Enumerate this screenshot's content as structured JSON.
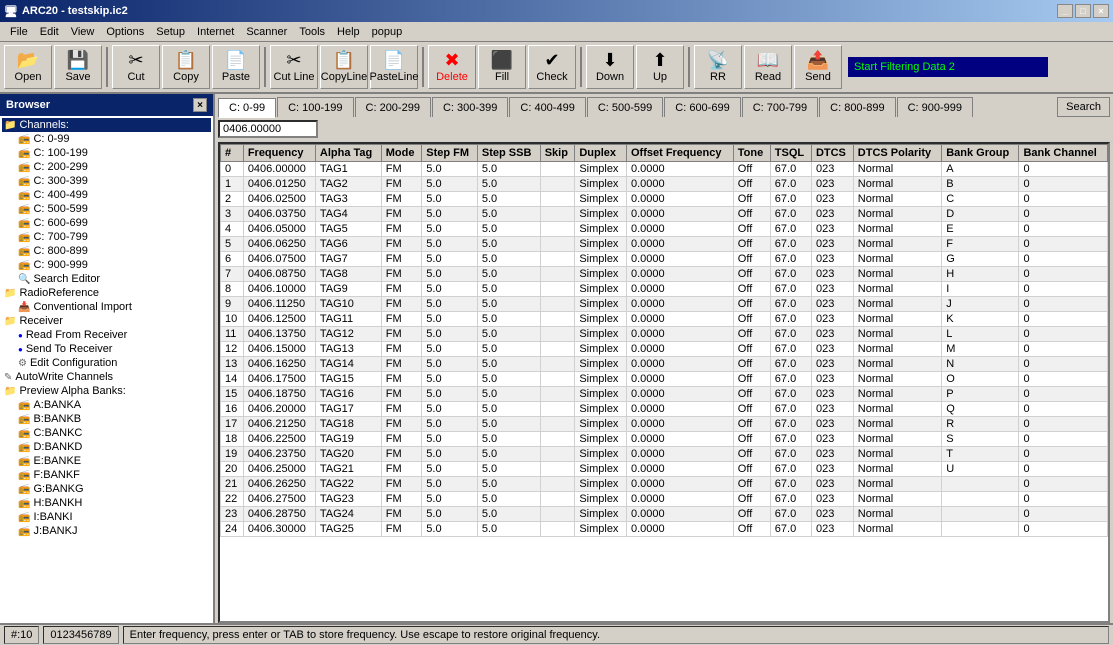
{
  "titleBar": {
    "title": "ARC20 - testskip.ic2",
    "controls": [
      "_",
      "□",
      "×"
    ]
  },
  "menuBar": {
    "items": [
      "File",
      "Edit",
      "View",
      "Options",
      "Setup",
      "Internet",
      "Scanner",
      "Tools",
      "Help",
      "popup"
    ]
  },
  "toolbar": {
    "buttons": [
      {
        "label": "Open",
        "icon": "📂"
      },
      {
        "label": "Save",
        "icon": "💾"
      },
      {
        "label": "Cut",
        "icon": "✂"
      },
      {
        "label": "Copy",
        "icon": "📋"
      },
      {
        "label": "Paste",
        "icon": "📄"
      },
      {
        "label": "Cut Line",
        "icon": "✂"
      },
      {
        "label": "CopyLine",
        "icon": "📋"
      },
      {
        "label": "PasteLine",
        "icon": "📄"
      },
      {
        "label": "Delete",
        "icon": "✖"
      },
      {
        "label": "Fill",
        "icon": "⬛"
      },
      {
        "label": "Check",
        "icon": "✔"
      },
      {
        "label": "Down",
        "icon": "⬇"
      },
      {
        "label": "Up",
        "icon": "⬆"
      },
      {
        "label": "RR",
        "icon": "📡"
      },
      {
        "label": "Read",
        "icon": "📖"
      },
      {
        "label": "Send",
        "icon": "📤"
      }
    ],
    "statusText": "Start Filtering Data 2"
  },
  "browser": {
    "title": "Browser",
    "tree": [
      {
        "label": "Channels:",
        "level": 0,
        "type": "folder",
        "selected": true
      },
      {
        "label": "C: 0-99",
        "level": 1,
        "type": "channel"
      },
      {
        "label": "C: 100-199",
        "level": 1,
        "type": "channel"
      },
      {
        "label": "C: 200-299",
        "level": 1,
        "type": "channel"
      },
      {
        "label": "C: 300-399",
        "level": 1,
        "type": "channel"
      },
      {
        "label": "C: 400-499",
        "level": 1,
        "type": "channel"
      },
      {
        "label": "C: 500-599",
        "level": 1,
        "type": "channel"
      },
      {
        "label": "C: 600-699",
        "level": 1,
        "type": "channel"
      },
      {
        "label": "C: 700-799",
        "level": 1,
        "type": "channel"
      },
      {
        "label": "C: 800-899",
        "level": 1,
        "type": "channel"
      },
      {
        "label": "C: 900-999",
        "level": 1,
        "type": "channel"
      },
      {
        "label": "Search Editor",
        "level": 1,
        "type": "item"
      },
      {
        "label": "RadioReference",
        "level": 0,
        "type": "folder"
      },
      {
        "label": "Conventional Import",
        "level": 1,
        "type": "item"
      },
      {
        "label": "Receiver",
        "level": 0,
        "type": "folder"
      },
      {
        "label": "Read From Receiver",
        "level": 1,
        "type": "dot"
      },
      {
        "label": "Send To Receiver",
        "level": 1,
        "type": "dot"
      },
      {
        "label": "Edit Configuration",
        "level": 1,
        "type": "item"
      },
      {
        "label": "AutoWrite Channels",
        "level": 0,
        "type": "item"
      },
      {
        "label": "Preview Alpha Banks:",
        "level": 0,
        "type": "folder"
      },
      {
        "label": "A:BANKA",
        "level": 1,
        "type": "channel"
      },
      {
        "label": "B:BANKB",
        "level": 1,
        "type": "channel"
      },
      {
        "label": "C:BANKC",
        "level": 1,
        "type": "channel"
      },
      {
        "label": "D:BANKD",
        "level": 1,
        "type": "channel"
      },
      {
        "label": "E:BANKE",
        "level": 1,
        "type": "channel"
      },
      {
        "label": "F:BANKF",
        "level": 1,
        "type": "channel"
      },
      {
        "label": "G:BANKG",
        "level": 1,
        "type": "channel"
      },
      {
        "label": "H:BANKH",
        "level": 1,
        "type": "channel"
      },
      {
        "label": "I:BANKI",
        "level": 1,
        "type": "channel"
      },
      {
        "label": "J:BANKJ",
        "level": 1,
        "type": "channel"
      }
    ]
  },
  "tabs": {
    "items": [
      "C: 0-99",
      "C: 100-199",
      "C: 200-299",
      "C: 300-399",
      "C: 400-499",
      "C: 500-599",
      "C: 600-699",
      "C: 700-799",
      "C: 800-899",
      "C: 900-999"
    ],
    "active": 0,
    "search": "Search"
  },
  "freqInput": {
    "value": "0406.00000"
  },
  "table": {
    "columns": [
      "#",
      "Frequency",
      "Alpha Tag",
      "Mode",
      "Step FM",
      "Step SSB",
      "Skip",
      "Duplex",
      "Offset Frequency",
      "Tone",
      "TSQL",
      "DTCS",
      "DTCS Polarity",
      "Bank Group",
      "Bank Channel"
    ],
    "rows": [
      [
        0,
        "0406.00000",
        "TAG1",
        "FM",
        "5.0",
        "5.0",
        "",
        "Simplex",
        "0.0000",
        "Off",
        "67.0",
        "023",
        "Normal",
        "A",
        0
      ],
      [
        1,
        "0406.01250",
        "TAG2",
        "FM",
        "5.0",
        "5.0",
        "",
        "Simplex",
        "0.0000",
        "Off",
        "67.0",
        "023",
        "Normal",
        "B",
        0
      ],
      [
        2,
        "0406.02500",
        "TAG3",
        "FM",
        "5.0",
        "5.0",
        "",
        "Simplex",
        "0.0000",
        "Off",
        "67.0",
        "023",
        "Normal",
        "C",
        0
      ],
      [
        3,
        "0406.03750",
        "TAG4",
        "FM",
        "5.0",
        "5.0",
        "",
        "Simplex",
        "0.0000",
        "Off",
        "67.0",
        "023",
        "Normal",
        "D",
        0
      ],
      [
        4,
        "0406.05000",
        "TAG5",
        "FM",
        "5.0",
        "5.0",
        "",
        "Simplex",
        "0.0000",
        "Off",
        "67.0",
        "023",
        "Normal",
        "E",
        0
      ],
      [
        5,
        "0406.06250",
        "TAG6",
        "FM",
        "5.0",
        "5.0",
        "",
        "Simplex",
        "0.0000",
        "Off",
        "67.0",
        "023",
        "Normal",
        "F",
        0
      ],
      [
        6,
        "0406.07500",
        "TAG7",
        "FM",
        "5.0",
        "5.0",
        "",
        "Simplex",
        "0.0000",
        "Off",
        "67.0",
        "023",
        "Normal",
        "G",
        0
      ],
      [
        7,
        "0406.08750",
        "TAG8",
        "FM",
        "5.0",
        "5.0",
        "",
        "Simplex",
        "0.0000",
        "Off",
        "67.0",
        "023",
        "Normal",
        "H",
        0
      ],
      [
        8,
        "0406.10000",
        "TAG9",
        "FM",
        "5.0",
        "5.0",
        "",
        "Simplex",
        "0.0000",
        "Off",
        "67.0",
        "023",
        "Normal",
        "I",
        0
      ],
      [
        9,
        "0406.11250",
        "TAG10",
        "FM",
        "5.0",
        "5.0",
        "",
        "Simplex",
        "0.0000",
        "Off",
        "67.0",
        "023",
        "Normal",
        "J",
        0
      ],
      [
        10,
        "0406.12500",
        "TAG11",
        "FM",
        "5.0",
        "5.0",
        "",
        "Simplex",
        "0.0000",
        "Off",
        "67.0",
        "023",
        "Normal",
        "K",
        0
      ],
      [
        11,
        "0406.13750",
        "TAG12",
        "FM",
        "5.0",
        "5.0",
        "",
        "Simplex",
        "0.0000",
        "Off",
        "67.0",
        "023",
        "Normal",
        "L",
        0
      ],
      [
        12,
        "0406.15000",
        "TAG13",
        "FM",
        "5.0",
        "5.0",
        "",
        "Simplex",
        "0.0000",
        "Off",
        "67.0",
        "023",
        "Normal",
        "M",
        0
      ],
      [
        13,
        "0406.16250",
        "TAG14",
        "FM",
        "5.0",
        "5.0",
        "",
        "Simplex",
        "0.0000",
        "Off",
        "67.0",
        "023",
        "Normal",
        "N",
        0
      ],
      [
        14,
        "0406.17500",
        "TAG15",
        "FM",
        "5.0",
        "5.0",
        "",
        "Simplex",
        "0.0000",
        "Off",
        "67.0",
        "023",
        "Normal",
        "O",
        0
      ],
      [
        15,
        "0406.18750",
        "TAG16",
        "FM",
        "5.0",
        "5.0",
        "",
        "Simplex",
        "0.0000",
        "Off",
        "67.0",
        "023",
        "Normal",
        "P",
        0
      ],
      [
        16,
        "0406.20000",
        "TAG17",
        "FM",
        "5.0",
        "5.0",
        "",
        "Simplex",
        "0.0000",
        "Off",
        "67.0",
        "023",
        "Normal",
        "Q",
        0
      ],
      [
        17,
        "0406.21250",
        "TAG18",
        "FM",
        "5.0",
        "5.0",
        "",
        "Simplex",
        "0.0000",
        "Off",
        "67.0",
        "023",
        "Normal",
        "R",
        0
      ],
      [
        18,
        "0406.22500",
        "TAG19",
        "FM",
        "5.0",
        "5.0",
        "",
        "Simplex",
        "0.0000",
        "Off",
        "67.0",
        "023",
        "Normal",
        "S",
        0
      ],
      [
        19,
        "0406.23750",
        "TAG20",
        "FM",
        "5.0",
        "5.0",
        "",
        "Simplex",
        "0.0000",
        "Off",
        "67.0",
        "023",
        "Normal",
        "T",
        0
      ],
      [
        20,
        "0406.25000",
        "TAG21",
        "FM",
        "5.0",
        "5.0",
        "",
        "Simplex",
        "0.0000",
        "Off",
        "67.0",
        "023",
        "Normal",
        "U",
        0
      ],
      [
        21,
        "0406.26250",
        "TAG22",
        "FM",
        "5.0",
        "5.0",
        "",
        "Simplex",
        "0.0000",
        "Off",
        "67.0",
        "023",
        "Normal",
        "",
        0
      ],
      [
        22,
        "0406.27500",
        "TAG23",
        "FM",
        "5.0",
        "5.0",
        "",
        "Simplex",
        "0.0000",
        "Off",
        "67.0",
        "023",
        "Normal",
        "",
        0
      ],
      [
        23,
        "0406.28750",
        "TAG24",
        "FM",
        "5.0",
        "5.0",
        "",
        "Simplex",
        "0.0000",
        "Off",
        "67.0",
        "023",
        "Normal",
        "",
        0
      ],
      [
        24,
        "0406.30000",
        "TAG25",
        "FM",
        "5.0",
        "5.0",
        "",
        "Simplex",
        "0.0000",
        "Off",
        "67.0",
        "023",
        "Normal",
        "",
        0
      ]
    ]
  },
  "statusBar": {
    "left": "#:10",
    "middle": "0123456789",
    "right": "Enter frequency, press enter or TAB to store frequency. Use escape to restore original frequency."
  }
}
